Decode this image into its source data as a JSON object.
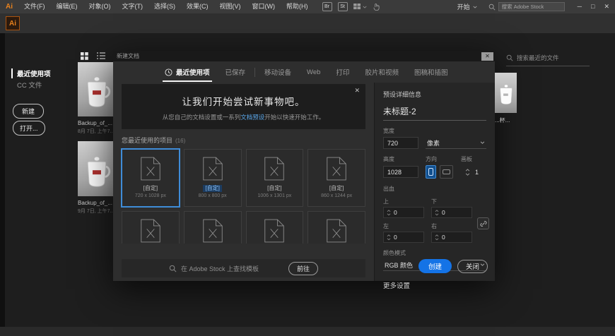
{
  "colors": {
    "accent": "#1473e6",
    "link": "#5aa6e8",
    "selection": "#3f8cd8",
    "logo_orange": "#e8821e"
  },
  "window": {
    "logo": "Ai",
    "menus": [
      "文件(F)",
      "编辑(E)",
      "对象(O)",
      "文字(T)",
      "选择(S)",
      "效果(C)",
      "视图(V)",
      "窗口(W)",
      "帮助(H)"
    ],
    "bridge_badge": "Br",
    "stock_badge": "St",
    "start_label": "开始",
    "stock_search_placeholder": "搜索 Adobe Stock",
    "minimize": "─",
    "maximize": "□",
    "close": "✕",
    "app_icon": "Ai"
  },
  "start_screen": {
    "sidebar": {
      "recent": "最近使用项",
      "cc_files": "CC 文件",
      "new_button": "新建",
      "open_button": "打开..."
    },
    "recent_search_placeholder": "搜索最近的文件",
    "files": [
      {
        "name": "Backup_of_...",
        "date": "8月 7日, 上午7..."
      },
      {
        "name": "Backup_of_...",
        "date": "9月 7日, 上午7..."
      },
      {
        "name": "...杯...",
        "date": ""
      }
    ]
  },
  "dialog": {
    "title": "新建文档",
    "close": "✕",
    "tabs": [
      {
        "label": "最近使用项"
      },
      {
        "label": "已保存"
      },
      {
        "label": "移动设备"
      },
      {
        "label": "Web"
      },
      {
        "label": "打印"
      },
      {
        "label": "胶片和视频"
      },
      {
        "label": "图稿和插图"
      }
    ],
    "banner": {
      "title": "让我们开始尝试新事物吧。",
      "desc_before": "从您自己的文档设置或一系列",
      "link_text": "文档预设",
      "desc_after": "开始以快速开始工作。",
      "close": "✕"
    },
    "recent_heading": "您最近使用的项目",
    "recent_count": "(16)",
    "presets": [
      {
        "label": "[自定]",
        "size": "720 x 1028 px"
      },
      {
        "label": "[自定]",
        "size": "800 x 800 px"
      },
      {
        "label": "[自定]",
        "size": "1006 x 1301 px"
      },
      {
        "label": "[自定]",
        "size": "860 x 1244 px"
      }
    ],
    "stock_search_placeholder": "在 Adobe Stock 上查找模板",
    "go_button": "前往",
    "details": {
      "heading": "预设详细信息",
      "doc_name": "未标题-2",
      "width_label": "宽度",
      "width_value": "720",
      "unit_value": "像素",
      "height_label": "高度",
      "height_value": "1028",
      "orientation_label": "方向",
      "artboards_label": "画板",
      "artboards_value": "1",
      "bleed_label": "出血",
      "bleed_top_label": "上",
      "bleed_top": "0",
      "bleed_bottom_label": "下",
      "bleed_bottom": "0",
      "bleed_left_label": "左",
      "bleed_left": "0",
      "bleed_right_label": "右",
      "bleed_right": "0",
      "color_mode_label": "颜色模式",
      "color_mode_value": "RGB 颜色",
      "more_settings": "更多设置",
      "create_button": "创建",
      "close_button": "关闭"
    }
  }
}
